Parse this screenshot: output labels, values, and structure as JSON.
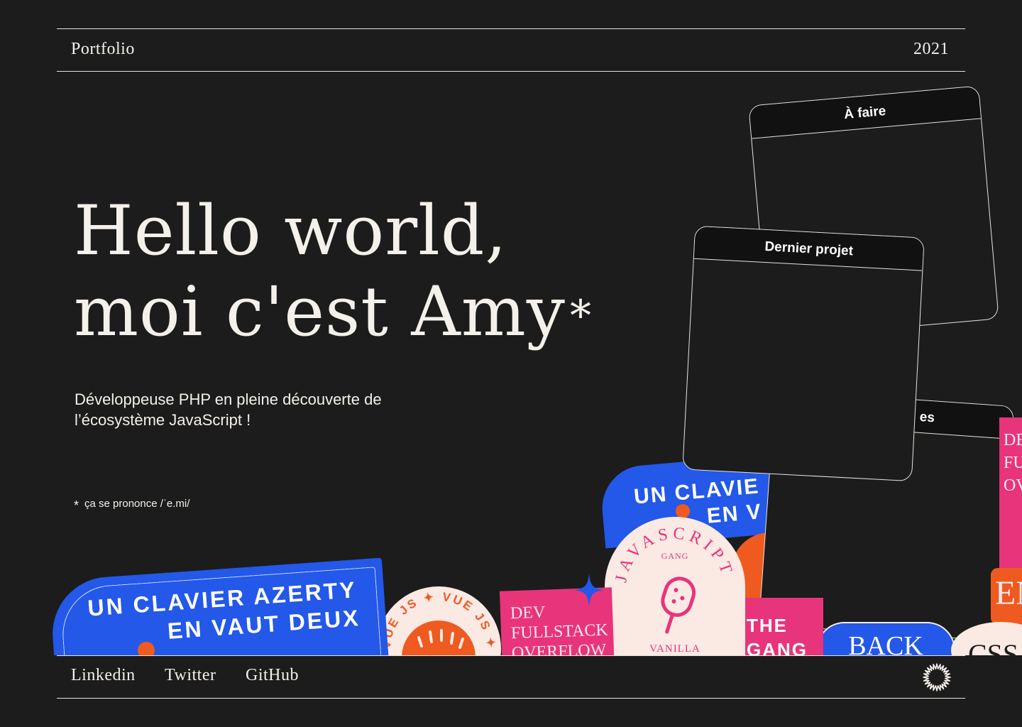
{
  "header": {
    "title": "Portfolio",
    "year": "2021"
  },
  "hero": {
    "line1": "Hello world,",
    "line2": "moi c'est Amy",
    "asterisk": "*"
  },
  "intro": {
    "line1": "Développeuse PHP en pleine découverte de",
    "line2": "l’écosystème JavaScript !"
  },
  "note": {
    "asterisk": "*",
    "text": "ça se prononce /ˈe.mi/"
  },
  "stickers": {
    "azerty_line1": "UN CLAVIER AZERTY",
    "azerty_line2": "EN VAUT DEUX",
    "azerty_small_line1": "UN CLAVIE",
    "azerty_small_line2": "EN V",
    "vue": "VUE JS ✦ VUE JS ✦",
    "dev_line1": "DEV",
    "dev_line2": "FULLSTACK",
    "dev_line3": "OVERFLOW",
    "js_arc": "JAVASCRIPT",
    "js_gang": "GANG",
    "js_vanilla": "VANILLA",
    "the_gang_line1": "THE",
    "the_gang_line2": "GANG",
    "back": "BACK",
    "css": "CSS",
    "right_dev_line1": "DE",
    "right_dev_line2": "FU",
    "right_dev_line3": "OV",
    "right_en": "EN"
  },
  "windows": {
    "todo": "À faire",
    "last_project": "Dernier projet",
    "third_partial": "es"
  },
  "footer": {
    "links": [
      "Linkedin",
      "Twitter",
      "GitHub"
    ],
    "icon": "starburst-icon"
  },
  "colors": {
    "background": "#1c1c1c",
    "blue": "#2358e8",
    "pink": "#e8347a",
    "orange": "#ef5a20",
    "cream": "#fbe9e4"
  }
}
